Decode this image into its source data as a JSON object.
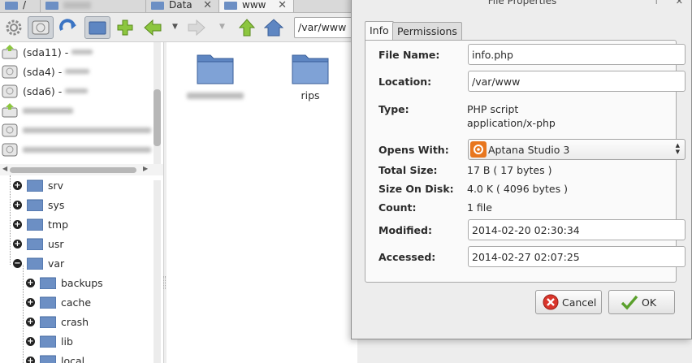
{
  "tabs": [
    {
      "label": "/",
      "active": false
    },
    {
      "label": "",
      "active": false
    },
    {
      "label": "Data",
      "active": false
    },
    {
      "label": "www",
      "active": true
    }
  ],
  "toolbar": {
    "path": "/var/www",
    "icons": [
      "settings-gear-icon",
      "drive-icon",
      "refresh-icon",
      "folder-view-icon",
      "new-tab-plus-icon",
      "back-arrow-icon",
      "forward-arrow-icon",
      "up-arrow-icon",
      "home-icon"
    ]
  },
  "devices": [
    {
      "label": "(sda11) -",
      "icon": "drive-mounted-icon"
    },
    {
      "label": "(sda4) -",
      "icon": "drive-icon"
    },
    {
      "label": "(sda6) -",
      "icon": "drive-icon"
    },
    {
      "label": "",
      "icon": "drive-mounted-icon"
    },
    {
      "label": "",
      "icon": "drive-icon"
    },
    {
      "label": "",
      "icon": "drive-icon"
    }
  ],
  "tree": [
    {
      "label": "srv",
      "expanded": false,
      "level": 1
    },
    {
      "label": "sys",
      "expanded": false,
      "level": 1
    },
    {
      "label": "tmp",
      "expanded": false,
      "level": 1
    },
    {
      "label": "usr",
      "expanded": false,
      "level": 1
    },
    {
      "label": "var",
      "expanded": true,
      "level": 1
    },
    {
      "label": "backups",
      "expanded": false,
      "level": 2
    },
    {
      "label": "cache",
      "expanded": false,
      "level": 2
    },
    {
      "label": "crash",
      "expanded": false,
      "level": 2
    },
    {
      "label": "lib",
      "expanded": false,
      "level": 2
    },
    {
      "label": "local",
      "expanded": false,
      "level": 2
    }
  ],
  "files": [
    {
      "label": "",
      "icon": "folder-icon"
    },
    {
      "label": "rips",
      "icon": "folder-icon"
    }
  ],
  "dialog": {
    "title": "File Properties",
    "tabs": [
      "Info",
      "Permissions"
    ],
    "active_tab": "Info",
    "fields": {
      "file_name_label": "File Name:",
      "file_name": "info.php",
      "location_label": "Location:",
      "location": "/var/www",
      "type_label": "Type:",
      "type_line1": "PHP script",
      "type_line2": "application/x-php",
      "opens_with_label": "Opens With:",
      "opens_with": "Aptana Studio 3",
      "total_size_label": "Total Size:",
      "total_size": "17 B  ( 17 bytes )",
      "size_on_disk_label": "Size On Disk:",
      "size_on_disk": "4.0 K  ( 4096 bytes )",
      "count_label": "Count:",
      "count": "1 file",
      "modified_label": "Modified:",
      "modified": "2014-02-20 02:30:34",
      "accessed_label": "Accessed:",
      "accessed": "2014-02-27 02:07:25"
    },
    "buttons": {
      "cancel": "Cancel",
      "ok": "OK"
    }
  },
  "colors": {
    "folder": "#6c8fc4",
    "accent": "#3a7bd5",
    "cancel": "#d9352b",
    "ok": "#5aa02c"
  }
}
